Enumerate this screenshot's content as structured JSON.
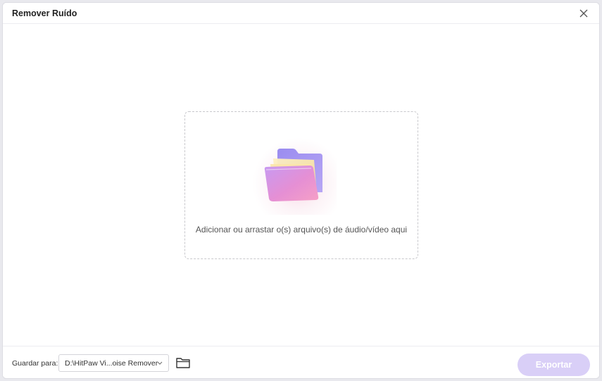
{
  "window": {
    "title": "Remover Ruído"
  },
  "dropzone": {
    "text": "Adicionar ou arrastar o(s) arquivo(s) de áudio/vídeo aqui",
    "icon": "folder-icon"
  },
  "footer": {
    "save_label": "Guardar para:",
    "path_value": "D:\\HitPaw Vi...oise Remover",
    "export_label": "Exportar"
  },
  "colors": {
    "accent_disabled": "#d9cff7",
    "border": "#c8c8cc",
    "text_primary": "#222222",
    "text_secondary": "#555555"
  }
}
